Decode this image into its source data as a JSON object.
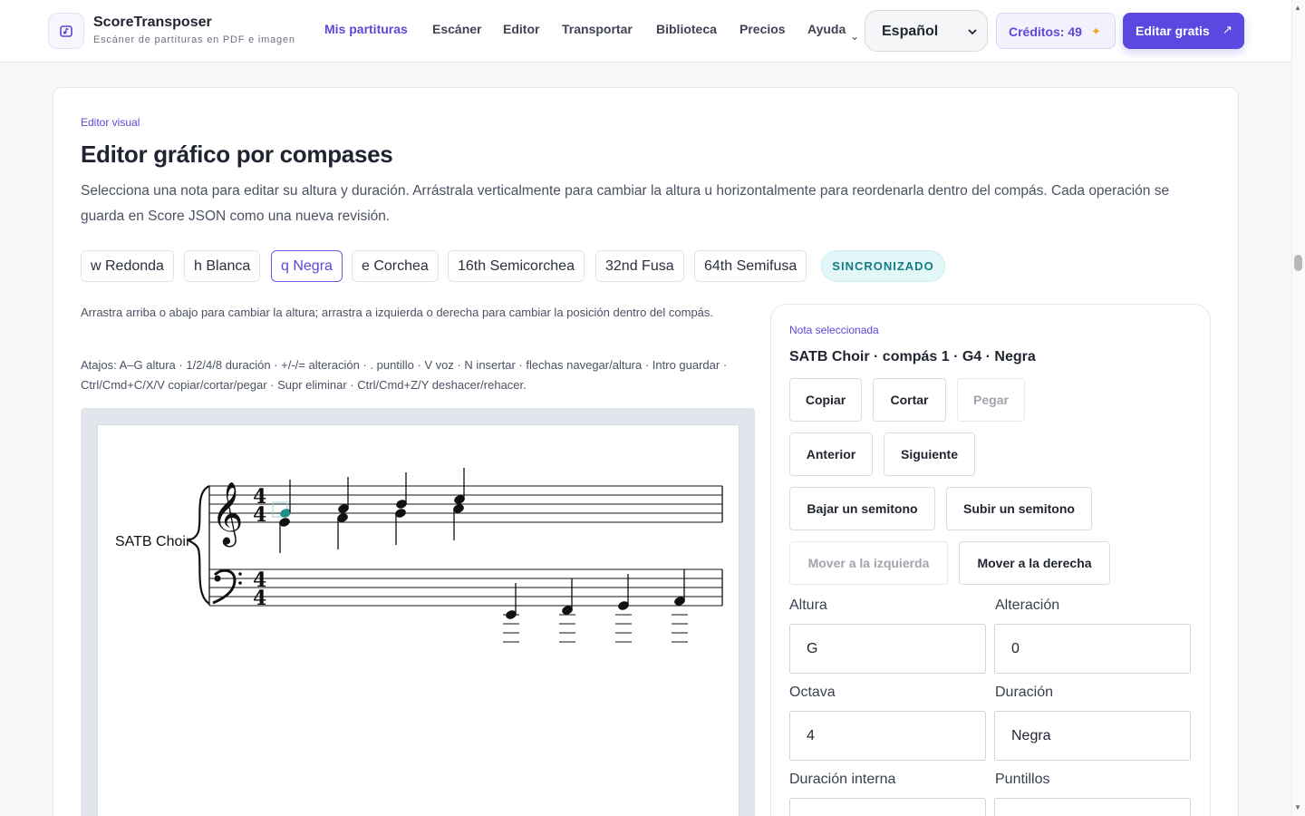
{
  "header": {
    "brand_name": "ScoreTransposer",
    "brand_subtitle": "Escáner de partituras en PDF e imagen",
    "nav": [
      "Mis partituras",
      "Escáner",
      "Editor",
      "Transportar",
      "Biblioteca",
      "Precios",
      "Ayuda"
    ],
    "nav_active_index": 0,
    "language": "Español",
    "credits_label": "Créditos: 49",
    "cta_label": "Editar gratis"
  },
  "main": {
    "eyebrow": "Editor visual",
    "title": "Editor gráfico por compases",
    "description": "Selecciona una nota para editar su altura y duración. Arrástrala verticalmente para cambiar la altura u horizontalmente para reordenarla dentro del compás. Cada operación se guarda en Score JSON como una nueva revisión.",
    "durations": [
      "w Redonda",
      "h Blanca",
      "q Negra",
      "e Corchea",
      "16th Semicorchea",
      "32nd Fusa",
      "64th Semifusa"
    ],
    "active_duration_index": 2,
    "sync_status": "SINCRONIZADO",
    "drag_hint": "Arrastra arriba o abajo para cambiar la altura; arrastra a izquierda o derecha para cambiar la posición dentro del compás.",
    "shortcuts": "Atajos: A–G altura · 1/2/4/8 duración · +/-/= alteración · . puntillo · V voz · N insertar · flechas navegar/altura · Intro guardar · Ctrl/Cmd+C/X/V copiar/cortar/pegar · Supr eliminar · Ctrl/Cmd+Z/Y deshacer/rehacer.",
    "score": {
      "part_name": "SATB Choir",
      "time_signature": "4/4"
    }
  },
  "panel": {
    "eyebrow": "Nota seleccionada",
    "title": "SATB Choir · compás 1 · G4 · Negra",
    "buttons": {
      "copy": "Copiar",
      "cut": "Cortar",
      "paste": "Pegar",
      "previous": "Anterior",
      "next": "Siguiente",
      "semitone_down": "Bajar un semitono",
      "semitone_up": "Subir un semitono",
      "move_left": "Mover a la izquierda",
      "move_right": "Mover a la derecha"
    },
    "fields": {
      "pitch_label": "Altura",
      "pitch_value": "G",
      "alteration_label": "Alteración",
      "alteration_value": "0",
      "octave_label": "Octava",
      "octave_value": "4",
      "duration_label": "Duración",
      "duration_value": "Negra",
      "internal_duration_label": "Duración interna",
      "dots_label": "Puntillos"
    }
  },
  "colors": {
    "accent": "#5b48e0",
    "sync": "#117c86",
    "selected_note": "#1f8f8a"
  }
}
